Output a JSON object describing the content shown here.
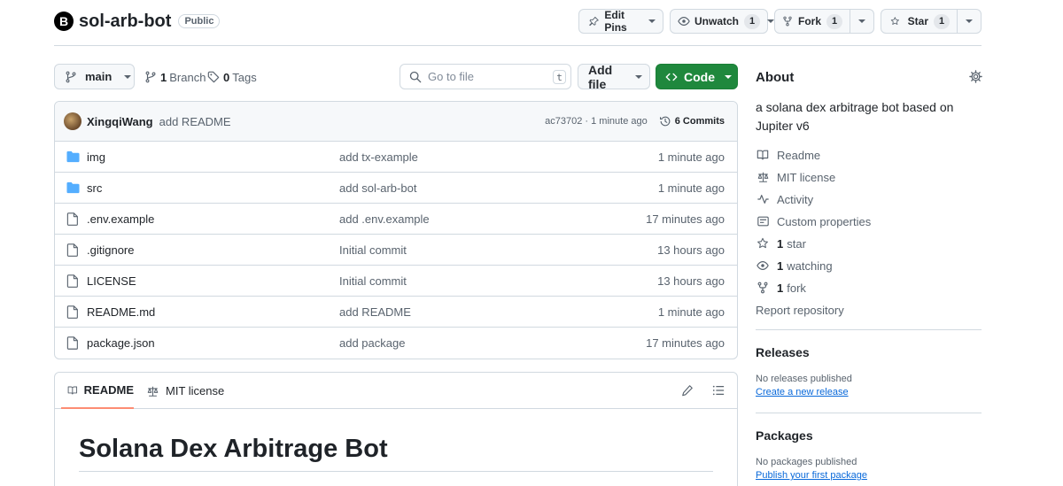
{
  "repo": {
    "owner_initial": "B",
    "name": "sol-arb-bot",
    "visibility": "Public"
  },
  "header_actions": {
    "edit_pins": "Edit Pins",
    "unwatch": "Unwatch",
    "unwatch_count": "1",
    "fork": "Fork",
    "fork_count": "1",
    "star": "Star",
    "star_count": "1"
  },
  "toolbar": {
    "branch": "main",
    "branches_count": "1",
    "branches_label": "Branch",
    "tags_count": "0",
    "tags_label": "Tags",
    "go_to_file_placeholder": "Go to file",
    "go_to_file_shortcut": "t",
    "add_file": "Add file",
    "code": "Code"
  },
  "latest_commit": {
    "author": "XingqiWang",
    "message": "add README",
    "hash_time": "ac73702 · 1 minute ago",
    "commits_label": "6 Commits"
  },
  "files": [
    {
      "type": "folder",
      "name": "img",
      "message": "add tx-example",
      "time": "1 minute ago"
    },
    {
      "type": "folder",
      "name": "src",
      "message": "add sol-arb-bot",
      "time": "1 minute ago"
    },
    {
      "type": "file",
      "name": ".env.example",
      "message": "add .env.example",
      "time": "17 minutes ago"
    },
    {
      "type": "file",
      "name": ".gitignore",
      "message": "Initial commit",
      "time": "13 hours ago"
    },
    {
      "type": "file",
      "name": "LICENSE",
      "message": "Initial commit",
      "time": "13 hours ago"
    },
    {
      "type": "file",
      "name": "README.md",
      "message": "add README",
      "time": "1 minute ago"
    },
    {
      "type": "file",
      "name": "package.json",
      "message": "add package",
      "time": "17 minutes ago"
    }
  ],
  "readme": {
    "tab_readme": "README",
    "tab_license": "MIT license",
    "heading": "Solana Dex Arbitrage Bot"
  },
  "about": {
    "title": "About",
    "description": "a solana dex arbitrage bot based on Jupiter v6",
    "links": {
      "readme": "Readme",
      "license": "MIT license",
      "activity": "Activity",
      "custom_properties": "Custom properties",
      "stars_count": "1",
      "stars_label": "star",
      "watching_count": "1",
      "watching_label": "watching",
      "forks_count": "1",
      "forks_label": "fork",
      "report": "Report repository"
    }
  },
  "releases": {
    "title": "Releases",
    "empty": "No releases published",
    "create_link": "Create a new release"
  },
  "packages": {
    "title": "Packages",
    "empty": "No packages published",
    "publish_link": "Publish your first package"
  },
  "colors": {
    "accent_green": "#1f883d",
    "folder_blue": "#54aeff",
    "link_blue": "#0969da",
    "tab_underline": "#fd8c73"
  }
}
